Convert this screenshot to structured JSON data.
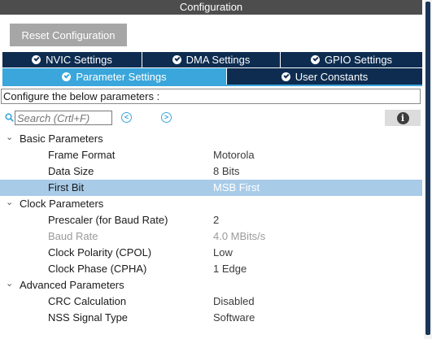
{
  "window": {
    "title": "Configuration"
  },
  "toolbar": {
    "reset_label": "Reset Configuration"
  },
  "tabs": {
    "row1": [
      {
        "label": "NVIC Settings",
        "active": false
      },
      {
        "label": "DMA Settings",
        "active": false
      },
      {
        "label": "GPIO Settings",
        "active": false
      }
    ],
    "row2": [
      {
        "label": "Parameter Settings",
        "active": true
      },
      {
        "label": "User Constants",
        "active": false
      }
    ]
  },
  "config_label": "Configure the below parameters :",
  "search": {
    "placeholder": "Search (Crtl+F)",
    "prev_icon": "chevron-left-circle-icon",
    "next_icon": "chevron-right-circle-icon",
    "info_icon": "info-icon"
  },
  "groups": [
    {
      "label": "Basic Parameters",
      "params": [
        {
          "name": "Frame Format",
          "value": "Motorola"
        },
        {
          "name": "Data Size",
          "value": "8 Bits"
        },
        {
          "name": "First Bit",
          "value": "MSB First",
          "selected": true
        }
      ]
    },
    {
      "label": "Clock Parameters",
      "params": [
        {
          "name": "Prescaler (for Baud Rate)",
          "value": "2"
        },
        {
          "name": "Baud Rate",
          "value": "4.0 MBits/s",
          "disabled": true
        },
        {
          "name": "Clock Polarity (CPOL)",
          "value": "Low"
        },
        {
          "name": "Clock Phase (CPHA)",
          "value": "1 Edge"
        }
      ]
    },
    {
      "label": "Advanced Parameters",
      "params": [
        {
          "name": "CRC Calculation",
          "value": "Disabled"
        },
        {
          "name": "NSS Signal Type",
          "value": "Software"
        }
      ]
    }
  ],
  "colors": {
    "tab_dark": "#0d2c50",
    "tab_active": "#3aa6db",
    "selected_row": "#a8cbe8",
    "title_bar": "#4d4d4d"
  }
}
